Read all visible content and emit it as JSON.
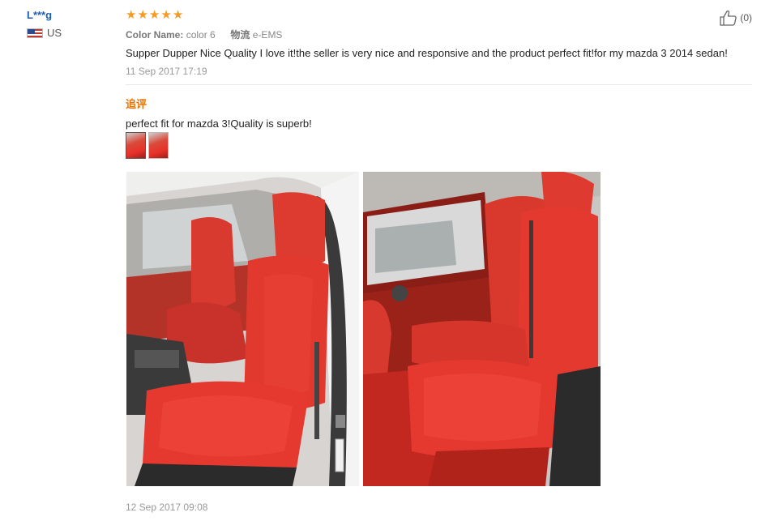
{
  "review": {
    "user": {
      "name": "L***g",
      "country": "US",
      "flag_icon": "us-flag-icon"
    },
    "rating": {
      "stars": 5,
      "max": 5,
      "color": "#f59a23"
    },
    "like": {
      "count_label": "(0)",
      "icon": "thumbs-up-icon"
    },
    "meta": {
      "color_label": "Color Name:",
      "color_value": "color 6",
      "shipping_label": "物流",
      "shipping_value": "e-EMS"
    },
    "text": "Supper Dupper Nice Quality I love it!the seller is very nice and responsive and the product perfect fit!for my mazda 3 2014 sedan!",
    "date": "11 Sep 2017 17:19",
    "followup": {
      "label": "追评",
      "text": "perfect fit for mazda 3!Quality is superb!",
      "thumbnails": [
        "thumbnail-1",
        "thumbnail-2"
      ],
      "photos": [
        "front-seat-photo",
        "rear-seat-photo"
      ],
      "date": "12 Sep 2017 09:08"
    }
  }
}
